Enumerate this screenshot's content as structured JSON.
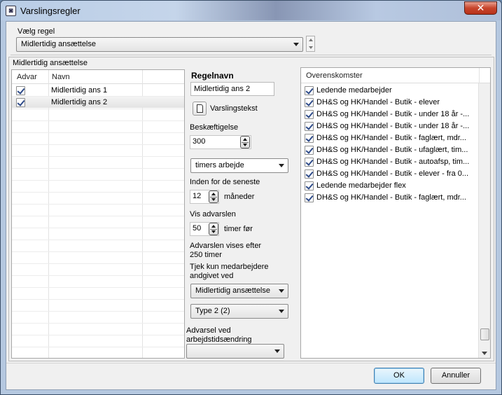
{
  "window": {
    "title": "Varslingsregler",
    "close_glyph": "✕"
  },
  "rule_select": {
    "label": "Vælg regel",
    "value": "Midlertidig ansættelse"
  },
  "panel_title": "Midlertidig ansættelse",
  "grid": {
    "headers": [
      "Advar",
      "Navn"
    ],
    "rows": [
      {
        "checked": true,
        "name": "Midlertidig ans 1",
        "selected": false
      },
      {
        "checked": true,
        "name": "Midlertidig ans 2",
        "selected": true
      }
    ]
  },
  "rule": {
    "name_label": "Regelnavn",
    "name_value": "Midlertidig ans 2",
    "alert_text_button": "Varslingstekst",
    "employment_label": "Beskæftigelse",
    "employment_value": "300",
    "unit_select": "timers arbejde",
    "within_label": "Inden for de seneste",
    "within_value": "12",
    "within_unit": "måneder",
    "show_label": "Vis advarslen",
    "show_value": "50",
    "show_unit": "timer før",
    "info_line1": "Advarslen vises efter",
    "info_line2": "250 timer",
    "check_label_line1": "Tjek kun medarbejdere",
    "check_label_line2": "andgivet ved",
    "employment_type_select": "Midlertidig ansættelse",
    "type_select": "Type 2 (2)",
    "change_label_line1": "Advarsel ved",
    "change_label_line2": "arbejdstidsændring",
    "change_select": ""
  },
  "agreements": {
    "header": "Overenskomster",
    "items": [
      {
        "checked": true,
        "label": "Ledende medarbejder"
      },
      {
        "checked": true,
        "label": "DH&S og HK/Handel - Butik - elever"
      },
      {
        "checked": true,
        "label": "DH&S og HK/Handel - Butik - under 18 år -..."
      },
      {
        "checked": true,
        "label": "DH&S og HK/Handel - Butik - under 18 år -..."
      },
      {
        "checked": true,
        "label": "DH&S og HK/Handel - Butik - faglært,  mdr..."
      },
      {
        "checked": true,
        "label": "DH&S og HK/Handel - Butik - ufaglært, tim..."
      },
      {
        "checked": true,
        "label": "DH&S og HK/Handel - Butik - autoafsp, tim..."
      },
      {
        "checked": true,
        "label": "DH&S og HK/Handel - Butik - elever - fra 0..."
      },
      {
        "checked": true,
        "label": "Ledende medarbejder flex"
      },
      {
        "checked": true,
        "label": "DH&S og HK/Handel - Butik - faglært,  mdr..."
      }
    ]
  },
  "buttons": {
    "ok": "OK",
    "cancel": "Annuller"
  }
}
